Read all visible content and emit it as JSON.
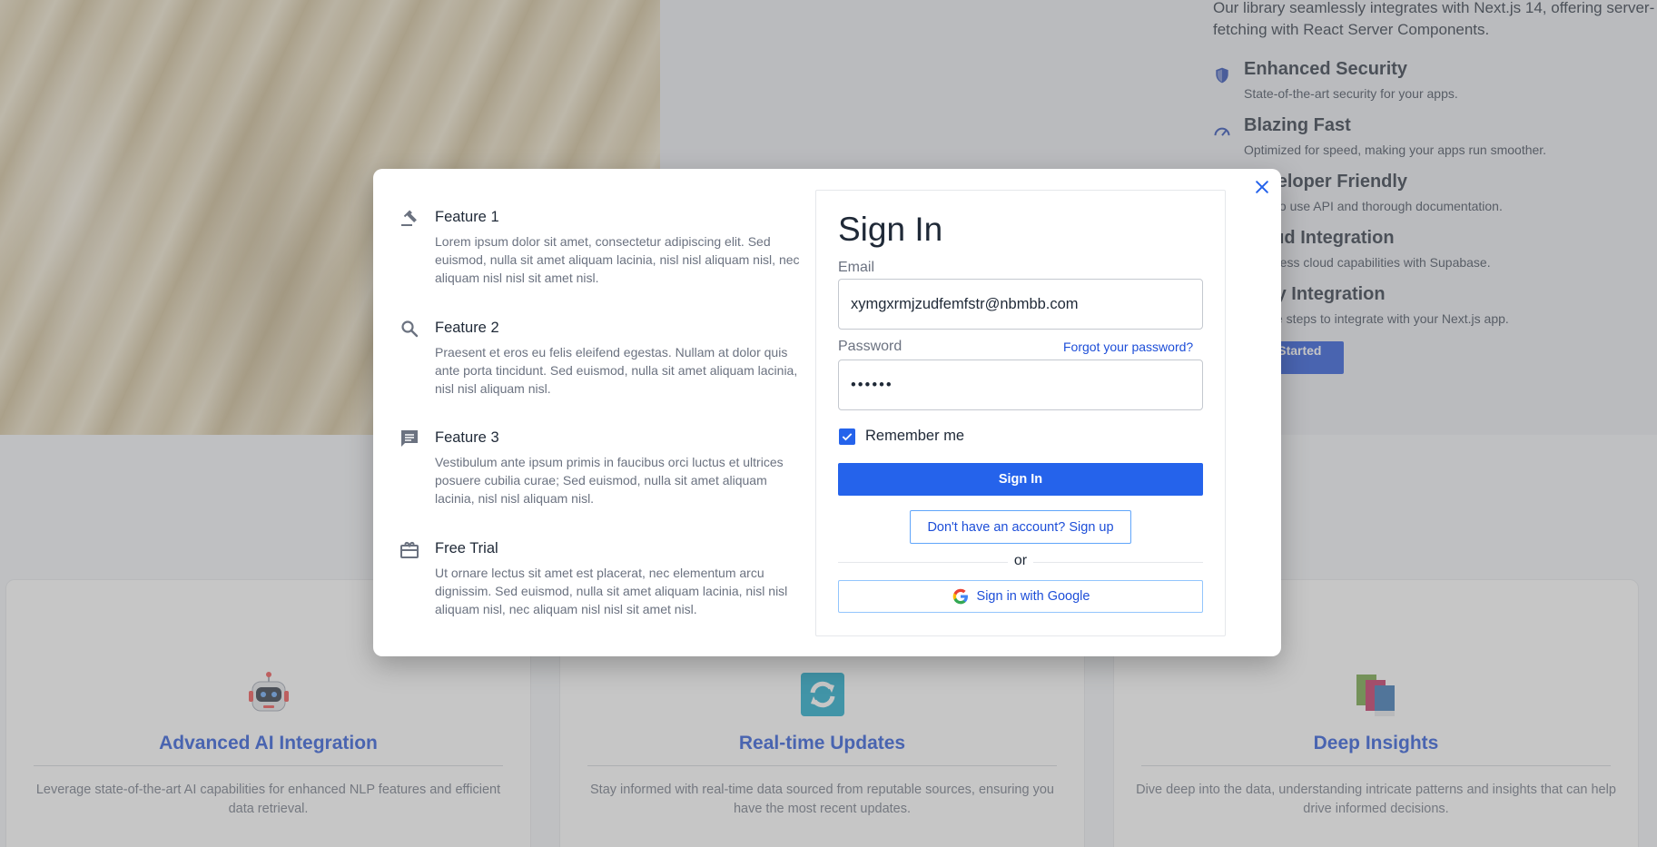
{
  "background": {
    "intro": "Our library seamlessly integrates with Next.js 14, offering server-fetching with React Server Components.",
    "features": [
      {
        "title": "Enhanced Security",
        "desc": "State-of-the-art security for your apps.",
        "icon": "shield-icon"
      },
      {
        "title": "Blazing Fast",
        "desc": "Optimized for speed, making your apps run smoother.",
        "icon": "speedometer-icon"
      },
      {
        "title": "Developer Friendly",
        "desc": "Easy to use API and thorough documentation.",
        "icon": "code-icon"
      },
      {
        "title": "Cloud Integration",
        "desc": "Seamless cloud capabilities with Supabase.",
        "icon": "cloud-icon"
      },
      {
        "title": "Easy Integration",
        "desc": "Simple steps to integrate with your Next.js app.",
        "icon": "puzzle-icon"
      }
    ],
    "cta_label": "Get Started Now",
    "cards": [
      {
        "title": "Advanced AI Integration",
        "desc": "Leverage state-of-the-art AI capabilities for enhanced NLP features and efficient data retrieval.",
        "icon": "robot-icon"
      },
      {
        "title": "Real-time Updates",
        "desc": "Stay informed with real-time data sourced from reputable sources, ensuring you have the most recent updates.",
        "icon": "refresh-icon"
      },
      {
        "title": "Deep Insights",
        "desc": "Dive deep into the data, understanding intricate patterns and insights that can help drive informed decisions.",
        "icon": "books-icon"
      }
    ]
  },
  "modal": {
    "features": [
      {
        "title": "Feature 1",
        "desc": "Lorem ipsum dolor sit amet, consectetur adipiscing elit. Sed euismod, nulla sit amet aliquam lacinia, nisl nisl aliquam nisl, nec aliquam nisl nisl sit amet nisl.",
        "icon": "gavel-icon"
      },
      {
        "title": "Feature 2",
        "desc": "Praesent et eros eu felis eleifend egestas. Nullam at dolor quis ante porta tincidunt. Sed euismod, nulla sit amet aliquam lacinia, nisl nisl aliquam nisl.",
        "icon": "search-icon"
      },
      {
        "title": "Feature 3",
        "desc": "Vestibulum ante ipsum primis in faucibus orci luctus et ultrices posuere cubilia curae; Sed euismod, nulla sit amet aliquam lacinia, nisl nisl aliquam nisl.",
        "icon": "chat-icon"
      },
      {
        "title": "Free Trial",
        "desc": "Ut ornare lectus sit amet est placerat, nec elementum arcu dignissim. Sed euismod, nulla sit amet aliquam lacinia, nisl nisl aliquam nisl, nec aliquam nisl nisl sit amet nisl.",
        "icon": "gift-icon"
      }
    ],
    "signin": {
      "title": "Sign In",
      "email_label": "Email",
      "email_value": "xymgxrmjzudfemfstr@nbmbb.com",
      "password_label": "Password",
      "password_value": "••••••",
      "forgot_label": "Forgot your password?",
      "remember_label": "Remember me",
      "remember_checked": true,
      "submit_label": "Sign In",
      "signup_label": "Don't have an account? Sign up",
      "or_label": "or",
      "google_label": "Sign in with Google"
    }
  },
  "colors": {
    "accent": "#2563eb",
    "link": "#1d4ed8",
    "overlay": "rgba(128,128,128,0.45)"
  }
}
